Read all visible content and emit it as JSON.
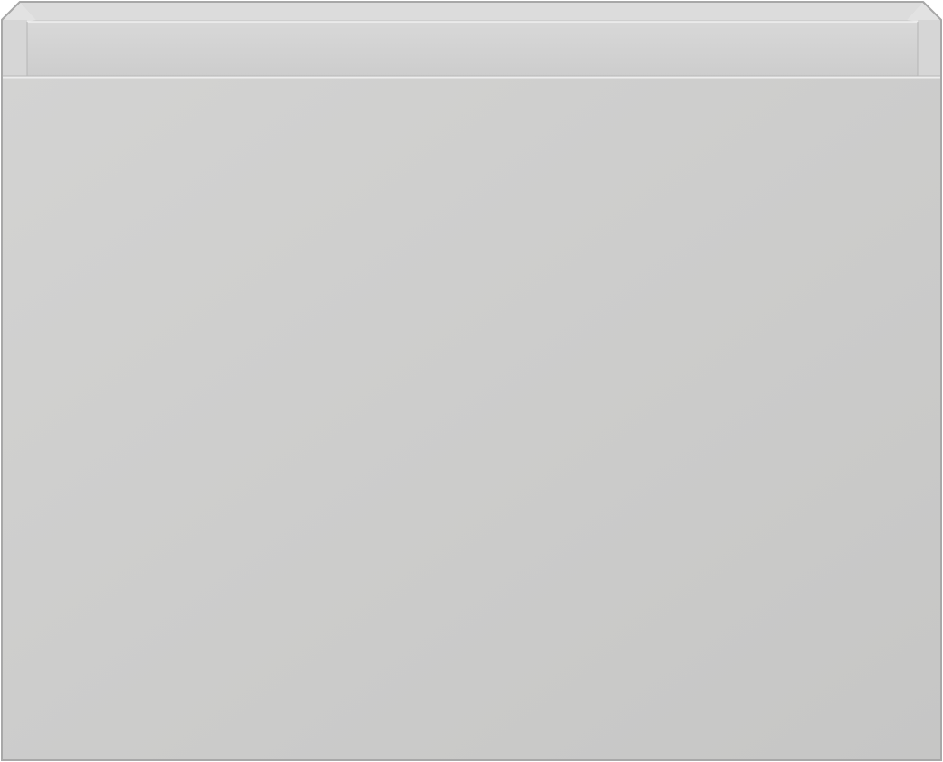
{
  "subject": "cabinet-front-view",
  "colors": {
    "background": "#ffffff",
    "outline": "#a8a8a8",
    "inner_back": "#dcdcdc",
    "top_rim": "#d4d4d4",
    "side_frame": "#cfcfcf",
    "front_panel_light": "#d2d2d1",
    "front_panel_dark": "#c7c7c6",
    "edge_highlight": "#efefef"
  }
}
